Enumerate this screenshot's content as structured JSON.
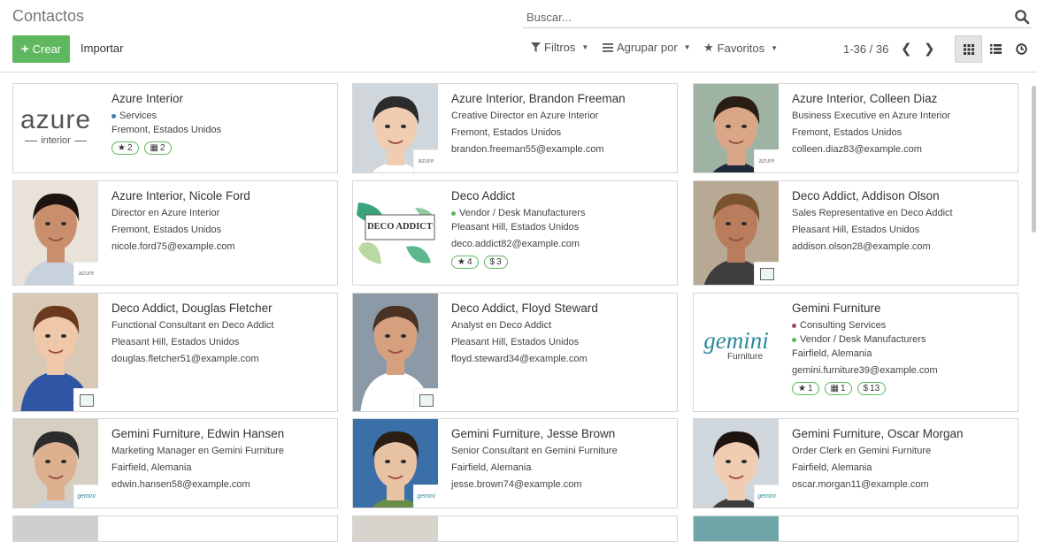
{
  "header": {
    "title": "Contactos",
    "search_placeholder": "Buscar...",
    "create_label": "Crear",
    "import_label": "Importar",
    "filters_label": "Filtros",
    "group_label": "Agrupar por",
    "favorites_label": "Favoritos",
    "pager": "1-36 / 36"
  },
  "colors": {
    "create_bg": "#5fb760",
    "badge_border": "#5cb85c",
    "services_tag": "#3c7db7",
    "vendor_tag": "#5cb85c",
    "consulting_tag": "#9c4a6c"
  },
  "contacts": [
    {
      "name": "Azure Interior",
      "tags": [
        {
          "label": "Services",
          "color": "#3c7db7"
        }
      ],
      "lines": [
        "Fremont, Estados Unidos"
      ],
      "badges": [
        {
          "icon": "star-icon",
          "value": "2"
        },
        {
          "icon": "calendar-icon",
          "value": "2"
        }
      ],
      "photo": "azure-logo"
    },
    {
      "name": "Azure Interior, Brandon Freeman",
      "tags": [],
      "lines": [
        "Creative Director en Azure Interior",
        "Fremont, Estados Unidos",
        "brandon.freeman55@example.com"
      ],
      "badges": [],
      "photo": "person",
      "mini": "azure"
    },
    {
      "name": "Azure Interior, Colleen Diaz",
      "tags": [],
      "lines": [
        "Business Executive en Azure Interior",
        "Fremont, Estados Unidos",
        "colleen.diaz83@example.com"
      ],
      "badges": [],
      "photo": "person",
      "mini": "azure"
    },
    {
      "name": "Azure Interior, Nicole Ford",
      "tags": [],
      "lines": [
        "Director en Azure Interior",
        "Fremont, Estados Unidos",
        "nicole.ford75@example.com"
      ],
      "badges": [],
      "photo": "person",
      "mini": "azure"
    },
    {
      "name": "Deco Addict",
      "tags": [
        {
          "label": "Vendor / Desk Manufacturers",
          "color": "#5cb85c"
        }
      ],
      "lines": [
        "Pleasant Hill, Estados Unidos",
        "deco.addict82@example.com"
      ],
      "badges": [
        {
          "icon": "star-icon",
          "value": "4"
        },
        {
          "icon": "dollar-icon",
          "value": "3"
        }
      ],
      "photo": "deco-logo"
    },
    {
      "name": "Deco Addict, Addison Olson",
      "tags": [],
      "lines": [
        "Sales Representative en Deco Addict",
        "Pleasant Hill, Estados Unidos",
        "addison.olson28@example.com"
      ],
      "badges": [],
      "photo": "person",
      "mini": "deco"
    },
    {
      "name": "Deco Addict, Douglas Fletcher",
      "tags": [],
      "lines": [
        "Functional Consultant en Deco Addict",
        "Pleasant Hill, Estados Unidos",
        "douglas.fletcher51@example.com"
      ],
      "badges": [],
      "photo": "person",
      "mini": "deco"
    },
    {
      "name": "Deco Addict, Floyd Steward",
      "tags": [],
      "lines": [
        "Analyst en Deco Addict",
        "Pleasant Hill, Estados Unidos",
        "floyd.steward34@example.com"
      ],
      "badges": [],
      "photo": "person",
      "mini": "deco"
    },
    {
      "name": "Gemini Furniture",
      "tags": [
        {
          "label": "Consulting Services",
          "color": "#9c4a6c"
        },
        {
          "label": "Vendor / Desk Manufacturers",
          "color": "#5cb85c"
        }
      ],
      "lines": [
        "Fairfield, Alemania",
        "gemini.furniture39@example.com"
      ],
      "badges": [
        {
          "icon": "star-icon",
          "value": "1"
        },
        {
          "icon": "calendar-icon",
          "value": "1"
        },
        {
          "icon": "dollar-icon",
          "value": "13"
        }
      ],
      "photo": "gemini-logo"
    },
    {
      "name": "Gemini Furniture, Edwin Hansen",
      "tags": [],
      "lines": [
        "Marketing Manager en Gemini Furniture",
        "Fairfield, Alemania",
        "edwin.hansen58@example.com"
      ],
      "badges": [],
      "photo": "person",
      "mini": "gemini"
    },
    {
      "name": "Gemini Furniture, Jesse Brown",
      "tags": [],
      "lines": [
        "Senior Consultant en Gemini Furniture",
        "Fairfield, Alemania",
        "jesse.brown74@example.com"
      ],
      "badges": [],
      "photo": "person",
      "mini": "gemini"
    },
    {
      "name": "Gemini Furniture, Oscar Morgan",
      "tags": [],
      "lines": [
        "Order Clerk en Gemini Furniture",
        "Fairfield, Alemania",
        "oscar.morgan11@example.com"
      ],
      "badges": [],
      "photo": "person",
      "mini": "gemini"
    }
  ],
  "logos": {
    "azure": [
      "azure",
      "interior"
    ],
    "deco": "DECO ADDICT",
    "gemini": [
      "gemini",
      "Furniture"
    ]
  }
}
